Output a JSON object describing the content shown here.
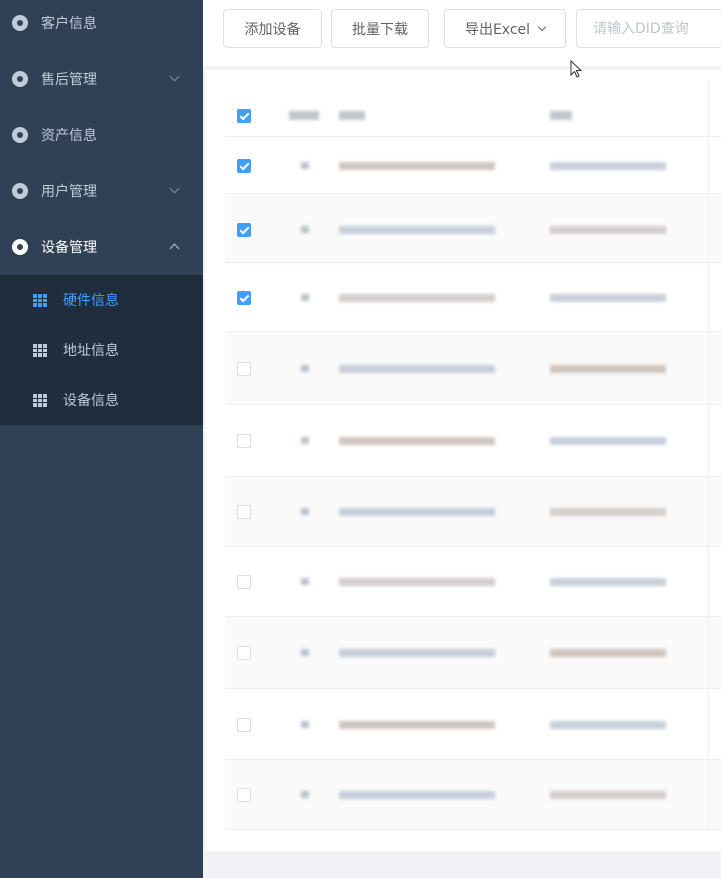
{
  "sidebar": {
    "menu": [
      {
        "label": "客户信息",
        "icon": "customer-icon"
      },
      {
        "label": "售后管理",
        "icon": "after-sales-icon"
      },
      {
        "label": "资产信息",
        "icon": "asset-icon"
      },
      {
        "label": "用户管理",
        "icon": "user-icon"
      },
      {
        "label": "设备管理",
        "icon": "device-icon"
      }
    ],
    "submenu": [
      {
        "label": "硬件信息",
        "icon": "grid-icon",
        "active": true
      },
      {
        "label": "地址信息",
        "icon": "grid-icon",
        "active": false
      },
      {
        "label": "设备信息",
        "icon": "grid-icon",
        "active": false
      }
    ]
  },
  "toolbar": {
    "add_label": "添加设备",
    "download_label": "批量下载",
    "export_label": "导出Excel",
    "search_placeholder": "请输入DID查询"
  },
  "colors": {
    "sidebar_bg": "#304156",
    "submenu_bg": "#1f2d3d",
    "accent": "#409eff"
  },
  "table": {
    "header_checked": true,
    "rows": [
      {
        "checked": true
      },
      {
        "checked": true
      },
      {
        "checked": true
      },
      {
        "checked": false
      },
      {
        "checked": false
      },
      {
        "checked": false
      },
      {
        "checked": false
      },
      {
        "checked": false
      },
      {
        "checked": false
      },
      {
        "checked": false
      }
    ]
  }
}
